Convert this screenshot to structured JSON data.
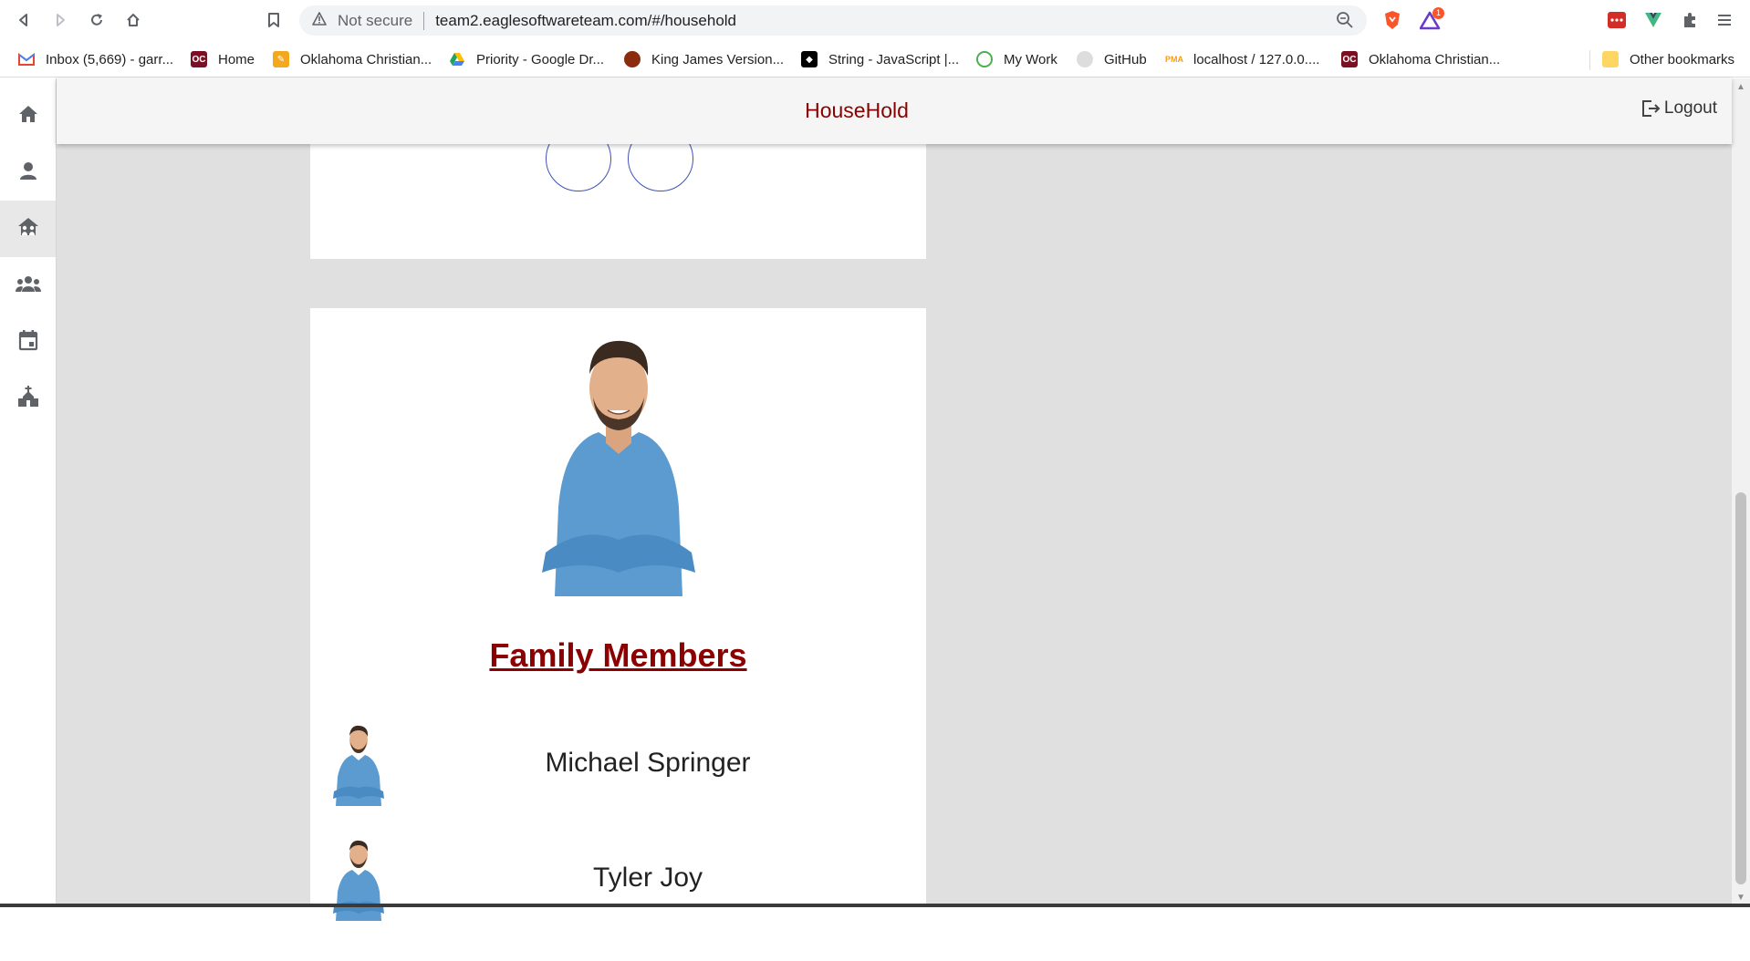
{
  "browser": {
    "not_secure": "Not secure",
    "url": "team2.eaglesoftwareteam.com/#/household",
    "brave_badge": "1"
  },
  "bookmarks": [
    {
      "label": "Inbox (5,669) - garr...",
      "icon": "gmail-icon",
      "color": "#ea4335"
    },
    {
      "label": "Home",
      "icon": "oc-icon",
      "color": "#7a1023"
    },
    {
      "label": "Oklahoma Christian...",
      "icon": "pencil-icon",
      "color": "#f4a81d"
    },
    {
      "label": "Priority - Google Dr...",
      "icon": "drive-icon",
      "color": "#1fa463"
    },
    {
      "label": "King James Version...",
      "icon": "book-icon",
      "color": "#8b2c0f"
    },
    {
      "label": "String - JavaScript |...",
      "icon": "mdn-icon",
      "color": "#000000"
    },
    {
      "label": "My Work",
      "icon": "swirl-icon",
      "color": "#4caf50"
    },
    {
      "label": "GitHub",
      "icon": "github-icon",
      "color": "#dddddd"
    },
    {
      "label": "localhost / 127.0.0....",
      "icon": "pma-icon",
      "color": "#f89c0e"
    },
    {
      "label": "Oklahoma Christian...",
      "icon": "oc-icon",
      "color": "#7a1023"
    }
  ],
  "other_bookmarks": "Other bookmarks",
  "sidenav": {
    "items": [
      {
        "name": "home-icon"
      },
      {
        "name": "person-icon"
      },
      {
        "name": "household-icon",
        "active": true
      },
      {
        "name": "group-icon"
      },
      {
        "name": "calendar-icon"
      },
      {
        "name": "church-icon"
      }
    ]
  },
  "appbar": {
    "title": "HouseHold",
    "logout_label": "Logout"
  },
  "household": {
    "section_title": "Family Members",
    "members": [
      {
        "name": "Michael Springer"
      },
      {
        "name": "Tyler Joy"
      }
    ]
  },
  "colors": {
    "brand": "#8b0000",
    "page_bg": "#e0e0e0",
    "accent_ring": "#3f51b5"
  }
}
